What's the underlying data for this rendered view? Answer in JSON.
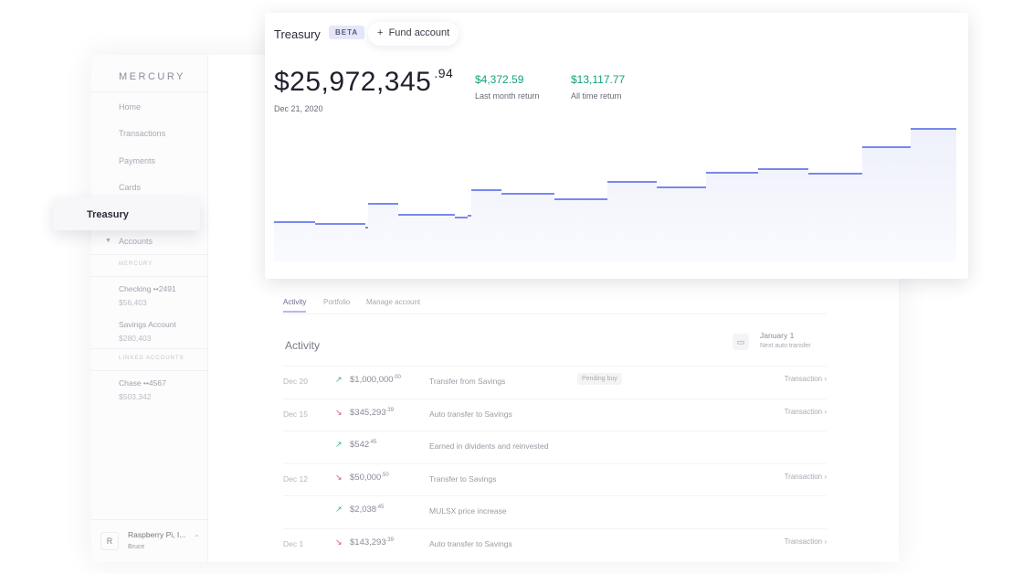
{
  "sidebar": {
    "brand": "MERCURY",
    "nav": [
      "Home",
      "Transactions",
      "Payments",
      "Cards"
    ],
    "active": "Treasury",
    "accounts_label": "Accounts",
    "section_mercury": "MERCURY",
    "section_linked": "LINKED ACCOUNTS",
    "accounts": [
      {
        "name": "Checking ••2491",
        "value": "$56,403"
      },
      {
        "name": "Savings Account",
        "value": "$280,403"
      },
      {
        "name": "Chase ••4567",
        "value": "$503,342"
      }
    ],
    "user": {
      "initial": "R",
      "org": "Raspberry Pi, I...",
      "name": "Bruce"
    }
  },
  "header": {
    "title": "Treasury",
    "badge": "BETA",
    "fund_button": "Fund account"
  },
  "balance": {
    "whole": "$25,972,345",
    "cents": ".94",
    "date": "Dec 21, 2020"
  },
  "stats": [
    {
      "value": "$4,372.59",
      "label": "Last month return"
    },
    {
      "value": "$13,117.77",
      "label": "All time return"
    }
  ],
  "chart": {
    "type": "step-area",
    "levels": [
      38,
      36,
      32,
      58,
      46,
      43,
      45,
      73,
      69,
      63,
      82,
      76,
      92,
      96,
      91,
      120,
      140
    ],
    "line_color": "#4f63e6"
  },
  "tabs": [
    "Activity",
    "Portfolio",
    "Manage account"
  ],
  "activity": {
    "title": "Activity",
    "next_date": "January 1",
    "next_label": "Next auto transfer",
    "rows": [
      {
        "date": "Dec 20",
        "dir": "up",
        "amount": "$1,000,000",
        "cents": ".00",
        "desc": "Transfer from Savings",
        "badge": "Pending buy",
        "link": "Transaction"
      },
      {
        "date": "Dec 15",
        "dir": "down",
        "amount": "$345,293",
        "cents": ".39",
        "desc": "Auto transfer to Savings",
        "link": "Transaction"
      },
      {
        "date": "",
        "dir": "up",
        "amount": "$542",
        "cents": ".45",
        "desc": "Earned in dividents and reinvested"
      },
      {
        "date": "Dec 12",
        "dir": "down",
        "amount": "$50,000",
        "cents": ".50",
        "desc": "Transfer to Savings",
        "link": "Transaction"
      },
      {
        "date": "",
        "dir": "up",
        "amount": "$2,038",
        "cents": ".45",
        "desc": "MULSX price increase"
      },
      {
        "date": "Dec 1",
        "dir": "down",
        "amount": "$143,293",
        "cents": ".39",
        "desc": "Auto transfer to Savings",
        "link": "Transaction"
      }
    ]
  },
  "colors": {
    "up": "#2bb59a",
    "down": "#e0468c",
    "accent": "#4f63e6",
    "green": "#14a07e"
  }
}
